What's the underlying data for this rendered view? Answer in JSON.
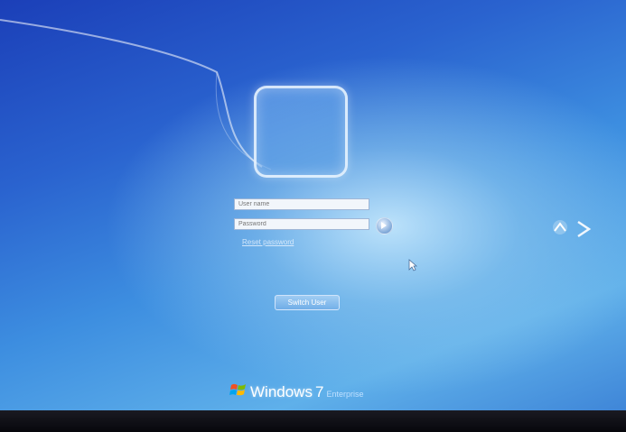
{
  "login": {
    "username_placeholder": "User name",
    "password_placeholder": "Password",
    "reset_link": "Reset password",
    "switch_user_label": "Switch User"
  },
  "brand": {
    "name": "Windows",
    "version": "7",
    "edition": "Enterprise"
  },
  "icons": [
    "user-picture-frame",
    "go-arrow-icon",
    "mouse-cursor-icon",
    "ease-of-access-icon",
    "windows-flag-icon"
  ]
}
